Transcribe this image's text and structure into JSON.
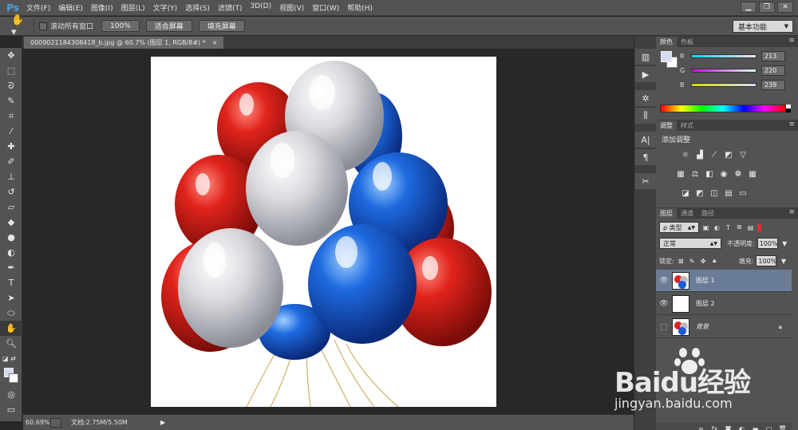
{
  "app": {
    "logo": "Ps"
  },
  "menu": [
    "文件(F)",
    "编辑(E)",
    "图像(I)",
    "图层(L)",
    "文字(Y)",
    "选择(S)",
    "滤镜(T)",
    "3D(D)",
    "视图(V)",
    "窗口(W)",
    "帮助(H)"
  ],
  "window_controls": {
    "minimize": "▁",
    "restore": "❐",
    "close": "✕"
  },
  "options": {
    "scroll_all_label": "滚动所有窗口",
    "btn_100": "100%",
    "btn_fit": "适合屏幕",
    "btn_fill": "填充屏幕",
    "workspace": "基本功能"
  },
  "document": {
    "tab_title": "0009021184308418_b.jpg @ 60.7% (图层 1, RGB/8#) *",
    "tab_close": "×"
  },
  "status": {
    "zoom": "60.69%",
    "doc_info": "文档:2.75M/5.50M"
  },
  "color_panel": {
    "tabs": [
      "颜色",
      "色板"
    ],
    "r_label": "R",
    "r_value": "213",
    "g_label": "G",
    "g_value": "220",
    "b_label": "B",
    "b_value": "239",
    "fg_color": "#d5dcef"
  },
  "adjust_panel": {
    "tabs": [
      "调整",
      "样式"
    ],
    "title": "添加调整"
  },
  "layers_panel": {
    "tabs": [
      "图层",
      "通道",
      "路径"
    ],
    "kind_filter": "ρ 类型",
    "blend_mode": "正常",
    "opacity_label": "不透明度:",
    "opacity_value": "100%",
    "lock_label": "锁定:",
    "fill_label": "填充:",
    "fill_value": "100%",
    "layers": [
      {
        "name": "图层 1",
        "selected": true,
        "visible": true
      },
      {
        "name": "图层 2",
        "selected": false,
        "visible": true
      },
      {
        "name": "背景",
        "selected": false,
        "visible": false
      }
    ]
  },
  "watermark": {
    "brand": "Baidu经验",
    "url": "jingyan.baidu.com"
  },
  "accent_colors": {
    "selection": "#6b7c96",
    "canvas_bg": "#ffffff",
    "workspace": "#282828"
  }
}
